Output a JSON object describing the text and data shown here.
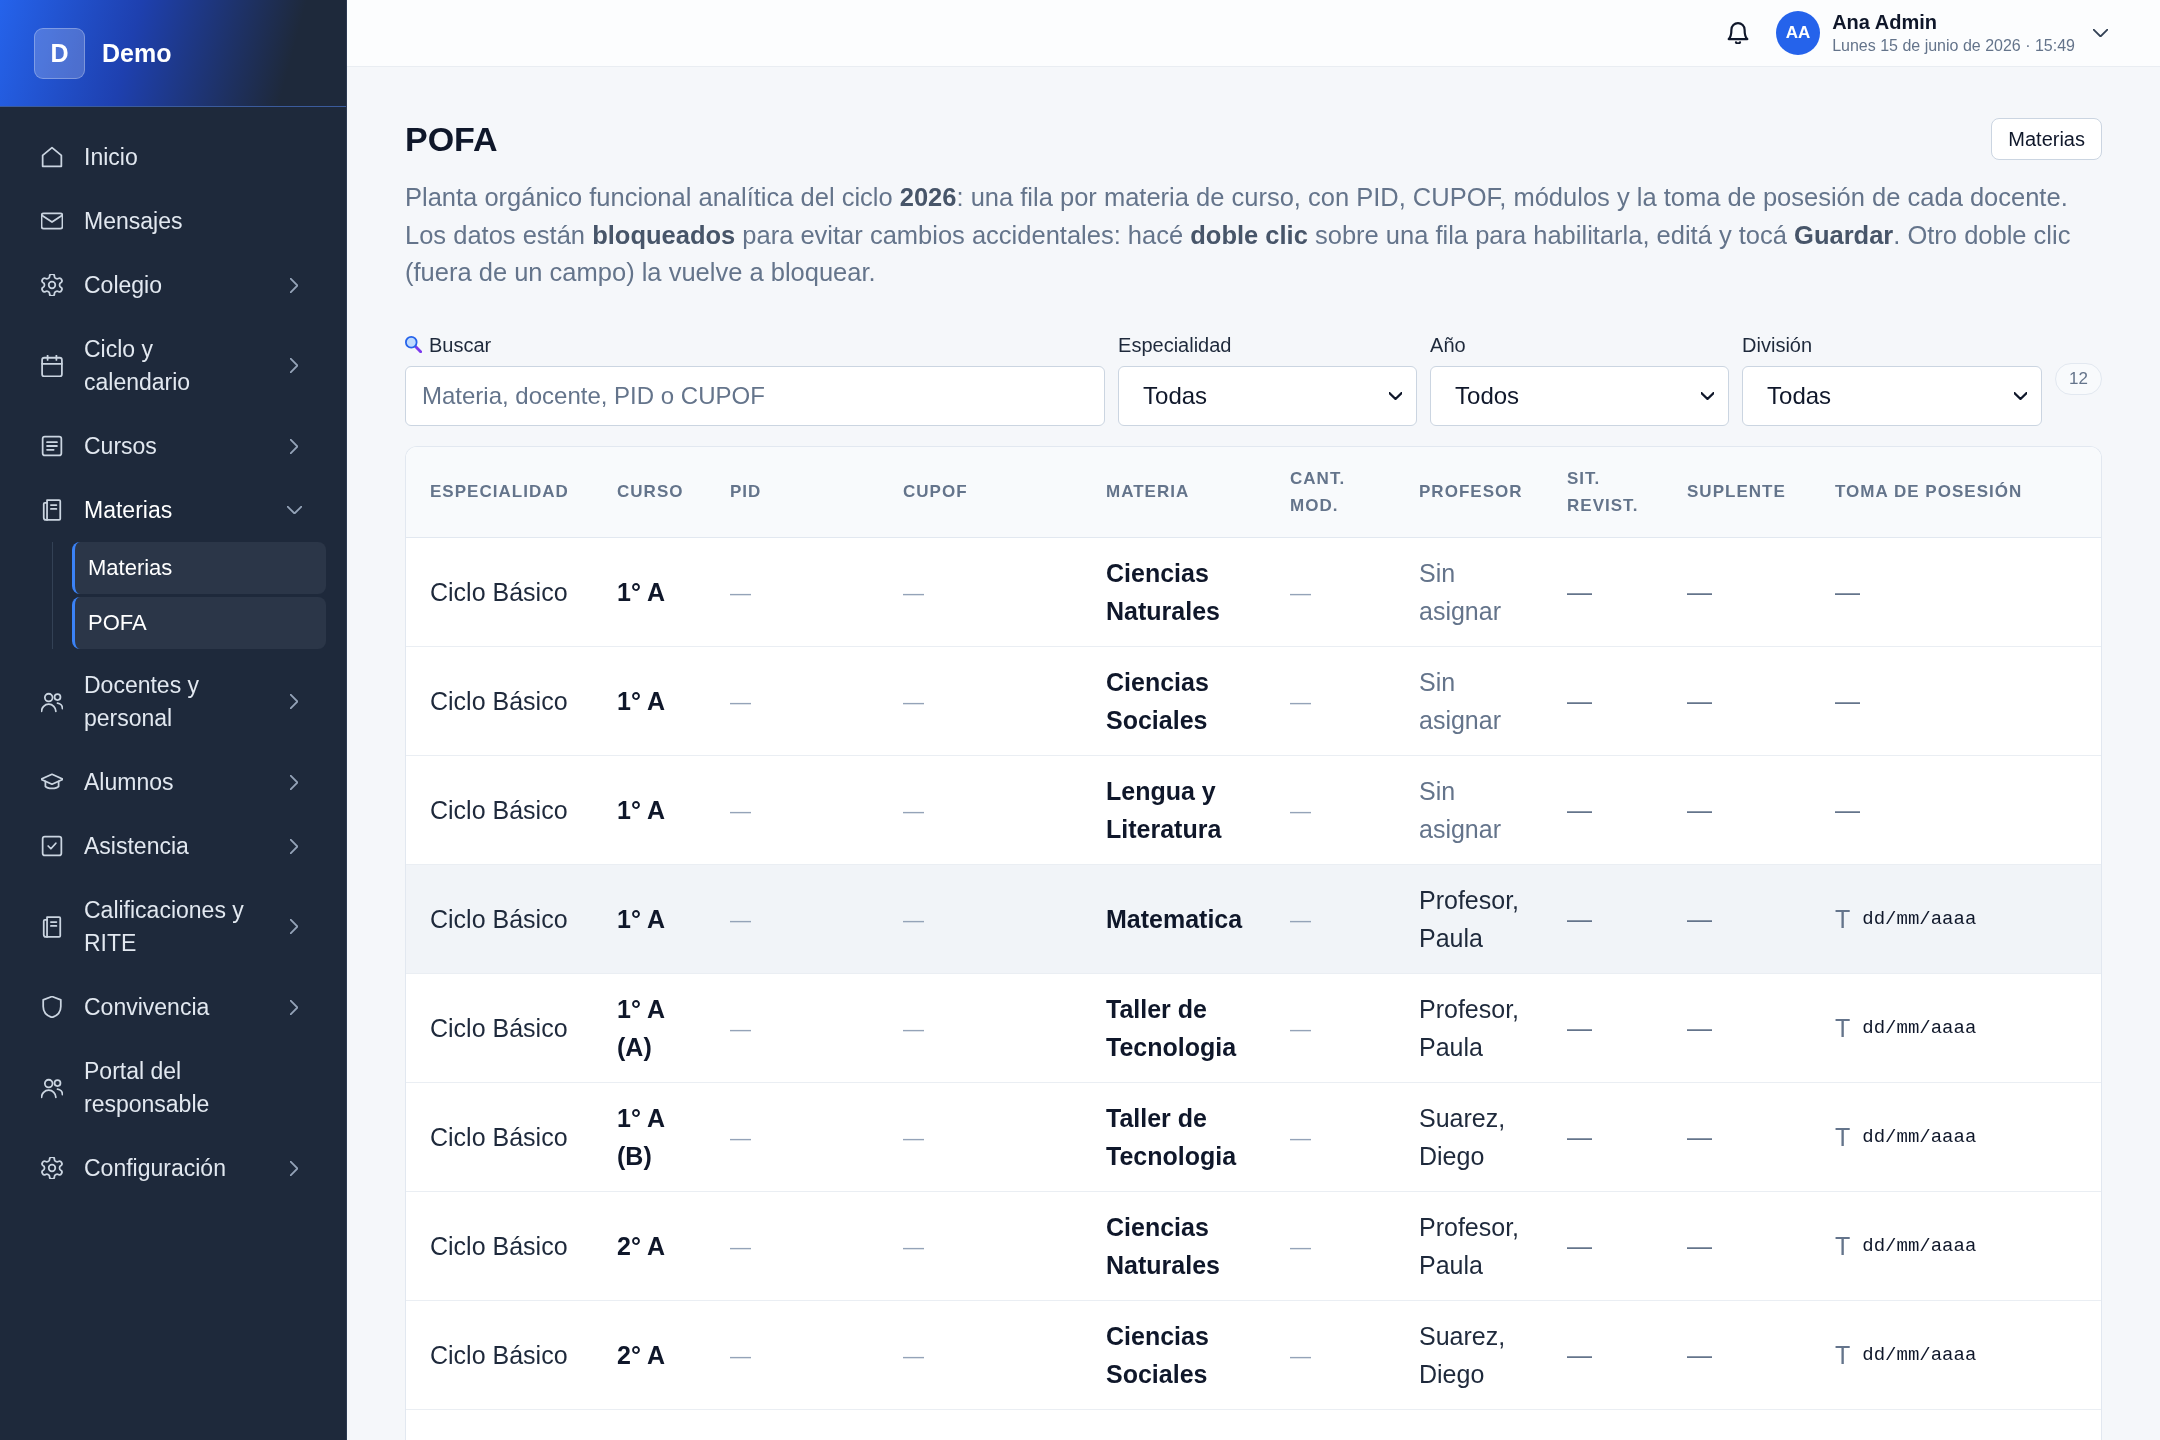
{
  "sidebar": {
    "brand": {
      "initial": "D",
      "name": "Demo"
    },
    "items": [
      {
        "kind": "link",
        "label": "Inicio"
      },
      {
        "kind": "link",
        "label": "Mensajes"
      },
      {
        "kind": "group",
        "label": "Colegio",
        "expanded": false
      },
      {
        "kind": "group",
        "label": "Ciclo y calendario",
        "expanded": false
      },
      {
        "kind": "group",
        "label": "Cursos",
        "expanded": false
      },
      {
        "kind": "group",
        "label": "Materias",
        "expanded": true,
        "children": [
          {
            "label": "Materias",
            "selected": true
          },
          {
            "label": "POFA",
            "selected": true
          }
        ]
      },
      {
        "kind": "group",
        "label": "Docentes y personal",
        "expanded": false
      },
      {
        "kind": "group",
        "label": "Alumnos",
        "expanded": false
      },
      {
        "kind": "group",
        "label": "Asistencia",
        "expanded": false
      },
      {
        "kind": "group",
        "label": "Calificaciones y RITE",
        "expanded": false
      },
      {
        "kind": "group",
        "label": "Convivencia",
        "expanded": false
      },
      {
        "kind": "link",
        "label": "Portal del responsable"
      },
      {
        "kind": "group",
        "label": "Configuración",
        "expanded": false
      }
    ]
  },
  "topbar": {
    "user": {
      "initials": "AA",
      "name": "Ana Admin",
      "date": "Lunes 15 de junio de 2026 · 15:49"
    }
  },
  "page": {
    "title": "POFA",
    "action": "Materias",
    "description": "Planta orgánico funcional analítica del ciclo **2026**: una fila por materia de curso, con PID, CUPOF, módulos y la toma de posesión de cada docente. Los datos están **bloqueados** para evitar cambios accidentales: hacé **doble clic** sobre una fila para habilitarla, editá y tocá **Guardar**. Otro doble clic (fuera de un campo) la vuelve a bloquear."
  },
  "filters": {
    "search": {
      "label": "Buscar",
      "placeholder": "Materia, docente, PID o CUPOF"
    },
    "selects": [
      {
        "label": "Especialidad",
        "value": "Todas"
      },
      {
        "label": "Año",
        "value": "Todos"
      },
      {
        "label": "División",
        "value": "Todas"
      }
    ],
    "count": "12"
  },
  "table": {
    "columns": [
      "ESPECIALIDAD",
      "CURSO",
      "PID",
      "CUPOF",
      "MATERIA",
      "CANT. MOD.",
      "PROFESOR",
      "SIT. REVIST.",
      "SUPLENTE",
      "TOMA DE POSESIÓN"
    ],
    "rows": [
      {
        "highlighted": false,
        "especialidad": "Ciclo Básico",
        "curso": "1° A",
        "pid": "—",
        "cupof": "—",
        "materia": "Ciencias Naturales",
        "cant_mod": "—",
        "profesor": {
          "name": "Sin asignar",
          "assigned": false
        },
        "sit_revist": "—",
        "suplente": "—",
        "toma_de_posesion": {
          "kind": "dash",
          "text": "—"
        }
      },
      {
        "highlighted": false,
        "especialidad": "Ciclo Básico",
        "curso": "1° A",
        "pid": "—",
        "cupof": "—",
        "materia": "Ciencias Sociales",
        "cant_mod": "—",
        "profesor": {
          "name": "Sin asignar",
          "assigned": false
        },
        "sit_revist": "—",
        "suplente": "—",
        "toma_de_posesion": {
          "kind": "dash",
          "text": "—"
        }
      },
      {
        "highlighted": false,
        "especialidad": "Ciclo Básico",
        "curso": "1° A",
        "pid": "—",
        "cupof": "—",
        "materia": "Lengua y Literatura",
        "cant_mod": "—",
        "profesor": {
          "name": "Sin asignar",
          "assigned": false
        },
        "sit_revist": "—",
        "suplente": "—",
        "toma_de_posesion": {
          "kind": "dash",
          "text": "—"
        }
      },
      {
        "highlighted": true,
        "especialidad": "Ciclo Básico",
        "curso": "1° A",
        "pid": "—",
        "cupof": "—",
        "materia": "Matematica",
        "cant_mod": "—",
        "profesor": {
          "name": "Profesor, Paula",
          "assigned": true
        },
        "sit_revist": "—",
        "suplente": "—",
        "toma_de_posesion": {
          "kind": "date",
          "prefix": "T",
          "placeholder": "dd/mm/aaaa"
        }
      },
      {
        "highlighted": false,
        "especialidad": "Ciclo Básico",
        "curso": "1° A (A)",
        "pid": "—",
        "cupof": "—",
        "materia": "Taller de Tecnologia",
        "cant_mod": "—",
        "profesor": {
          "name": "Profesor, Paula",
          "assigned": true
        },
        "sit_revist": "—",
        "suplente": "—",
        "toma_de_posesion": {
          "kind": "date",
          "prefix": "T",
          "placeholder": "dd/mm/aaaa"
        }
      },
      {
        "highlighted": false,
        "especialidad": "Ciclo Básico",
        "curso": "1° A (B)",
        "pid": "—",
        "cupof": "—",
        "materia": "Taller de Tecnologia",
        "cant_mod": "—",
        "profesor": {
          "name": "Suarez, Diego",
          "assigned": true
        },
        "sit_revist": "—",
        "suplente": "—",
        "toma_de_posesion": {
          "kind": "date",
          "prefix": "T",
          "placeholder": "dd/mm/aaaa"
        }
      },
      {
        "highlighted": false,
        "especialidad": "Ciclo Básico",
        "curso": "2° A",
        "pid": "—",
        "cupof": "—",
        "materia": "Ciencias Naturales",
        "cant_mod": "—",
        "profesor": {
          "name": "Profesor, Paula",
          "assigned": true
        },
        "sit_revist": "—",
        "suplente": "—",
        "toma_de_posesion": {
          "kind": "date",
          "prefix": "T",
          "placeholder": "dd/mm/aaaa"
        }
      },
      {
        "highlighted": false,
        "especialidad": "Ciclo Básico",
        "curso": "2° A",
        "pid": "—",
        "cupof": "—",
        "materia": "Ciencias Sociales",
        "cant_mod": "—",
        "profesor": {
          "name": "Suarez, Diego",
          "assigned": true
        },
        "sit_revist": "—",
        "suplente": "—",
        "toma_de_posesion": {
          "kind": "date",
          "prefix": "T",
          "placeholder": "dd/mm/aaaa"
        }
      }
    ]
  }
}
